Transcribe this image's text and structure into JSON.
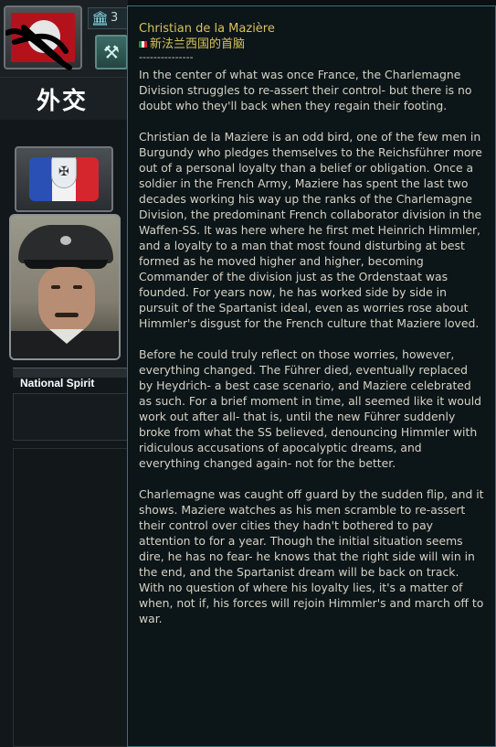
{
  "left_panel": {
    "political_power_value": "3",
    "page_title": "外交",
    "national_spirit_label": "National Spirit",
    "tricolor_colors": [
      "#2a4fb5",
      "#f2f2f2",
      "#d6262d"
    ]
  },
  "tooltip": {
    "leader_name": "Christian de la Mazière",
    "country_name": "新法兰西国的首脑",
    "separator": "---------------",
    "paragraphs": [
      "In the center of what was once France, the Charlemagne Division struggles to re-assert their control- but there is no doubt who they'll back when they regain their footing.",
      "Christian de la Maziere is an odd bird, one of the few men in Burgundy who pledges themselves to the Reichsführer more out of a personal loyalty than a belief or obligation. Once a soldier in the French Army, Maziere has spent the last two decades working his way up the ranks of the Charlemagne Division, the predominant French collaborator division in the Waffen-SS. It was here where he first met Heinrich Himmler, and a loyalty to a man that most found disturbing at best formed as he moved higher and higher, becoming Commander of the division just as the Ordenstaat was founded. For years now, he has worked side by side in pursuit of the Spartanist ideal, even as worries rose about Himmler's disgust for the French culture that Maziere loved.",
      "Before he could truly reflect on those worries, however, everything changed. The Führer died, eventually replaced by Heydrich- a best case scenario, and Maziere celebrated as such. For a brief moment in time, all seemed like it would work out after all- that is, until the new Führer suddenly broke from what the SS believed, denouncing Himmler with ridiculous accusations of apocalyptic dreams, and everything changed again- not for the better.",
      "Charlemagne was caught off guard by the sudden flip, and it shows. Maziere watches as his men scramble to re-assert their control over cities they hadn't bothered to pay attention to for a year. Though the initial situation seems dire, he has no fear- he knows that the right side will win in the end, and the Spartanist dream will be back on track. With no question of where his loyalty lies, it's a matter of when, not if, his forces will rejoin Himmler's and march off to war."
    ]
  },
  "colors": {
    "tooltip_bg": "#0c1518",
    "tooltip_border": "#3e6f78",
    "heading_gold": "#d8c25a",
    "body_text": "#d6d2c4"
  },
  "icons": {
    "political_power": "pillared-building-icon",
    "decisions": "hammer-icon",
    "country_flag": "tricolor-flag-icon"
  }
}
